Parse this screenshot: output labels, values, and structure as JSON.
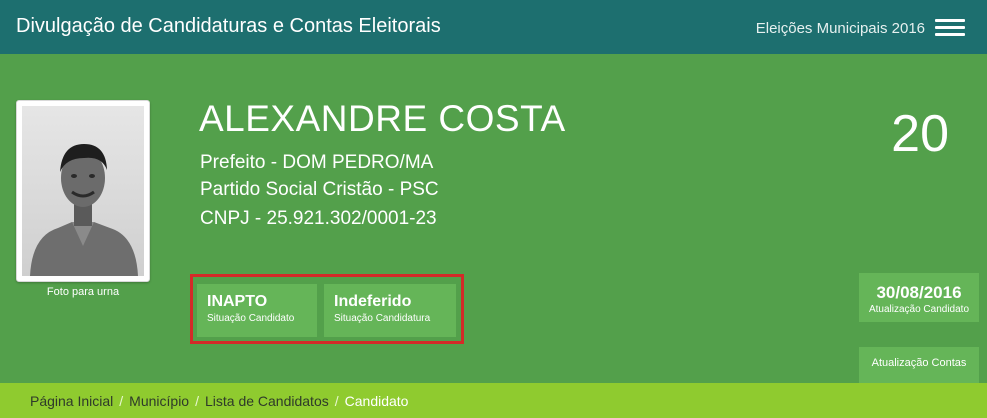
{
  "header": {
    "title": "Divulgação de Candidaturas e Contas Eleitorais",
    "election": "Eleições Municipais 2016",
    "menu_icon": "hamburger-menu-icon"
  },
  "candidate": {
    "name": "ALEXANDRE COSTA",
    "office": "Prefeito - DOM PEDRO/MA",
    "party": "Partido Social Cristão - PSC",
    "cnpj": "CNPJ - 25.921.302/0001-23",
    "number": "20",
    "photo_caption": "Foto para urna"
  },
  "status": {
    "candidate_status": {
      "value": "INAPTO",
      "label": "Situação Candidato"
    },
    "candidacy_status": {
      "value": "Indeferido",
      "label": "Situação Candidatura"
    }
  },
  "updates": {
    "candidate": {
      "value": "30/08/2016",
      "label": "Atualização Candidato"
    },
    "accounts": {
      "label": "Atualização Contas"
    }
  },
  "breadcrumb": {
    "items": [
      "Página Inicial",
      "Município",
      "Lista de Candidatos",
      "Candidato"
    ],
    "separator": "/"
  },
  "colors": {
    "topbar": "#1d6f6f",
    "hero": "#53a04b",
    "card": "#65b558",
    "highlight_border": "#d42a28",
    "breadcrumb": "#8fcb2f"
  }
}
